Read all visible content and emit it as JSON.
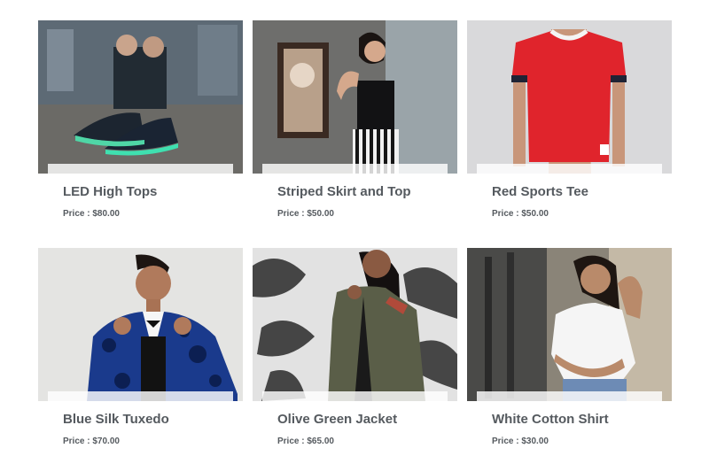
{
  "products": [
    {
      "title": "LED High Tops",
      "price_label": "Price :",
      "price": "$80.00",
      "image": "sneakers-photo"
    },
    {
      "title": "Striped Skirt and Top",
      "price_label": "Price :",
      "price": "$50.00",
      "image": "woman-striped-skirt-photo"
    },
    {
      "title": "Red Sports Tee",
      "price_label": "Price :",
      "price": "$50.00",
      "image": "red-tee-photo"
    },
    {
      "title": "Blue Silk Tuxedo",
      "price_label": "Price :",
      "price": "$70.00",
      "image": "man-blue-tuxedo-photo"
    },
    {
      "title": "Olive Green Jacket",
      "price_label": "Price :",
      "price": "$65.00",
      "image": "woman-olive-jacket-photo"
    },
    {
      "title": "White Cotton Shirt",
      "price_label": "Price :",
      "price": "$30.00",
      "image": "woman-white-shirt-photo"
    }
  ],
  "colors": {
    "text": "#555a5f",
    "background": "#ffffff"
  }
}
